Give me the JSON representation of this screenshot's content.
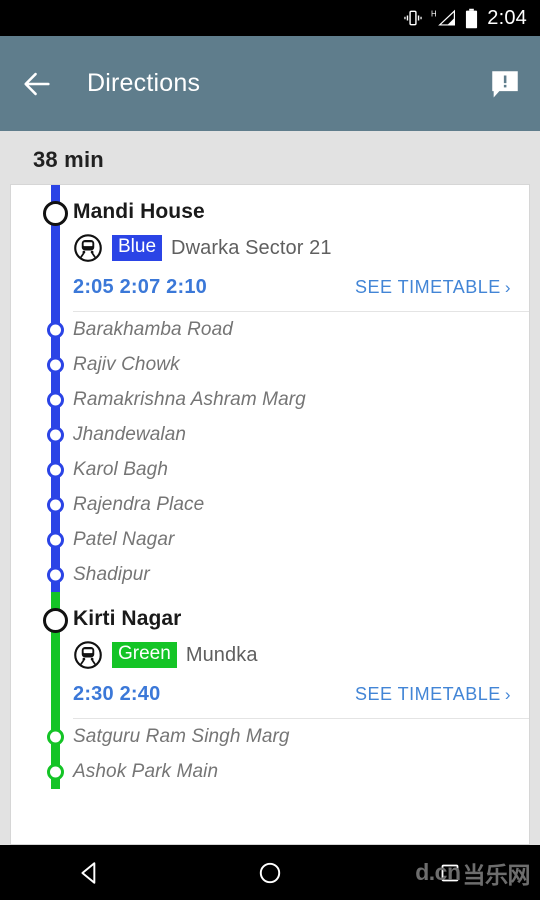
{
  "statusbar": {
    "time": "2:04",
    "icons": [
      "vibrate-icon",
      "network-h-icon",
      "battery-icon"
    ],
    "network_label": "H"
  },
  "toolbar": {
    "title": "Directions",
    "back_icon": "back-arrow-icon",
    "report_icon": "report-problem-icon",
    "background_color": "#5f7d8c"
  },
  "summary": {
    "duration": "38 min"
  },
  "legs": [
    {
      "color": "#2b44e6",
      "color_name": "blue",
      "station": "Mandi House",
      "mode_icon": "subway-icon",
      "line_badge": "Blue",
      "headsign": "Dwarka Sector 21",
      "departures": "2:05 2:07 2:10",
      "timetable_label": "SEE TIMETABLE",
      "timetable_chevron": "›",
      "stops": [
        "Barakhamba Road",
        "Rajiv Chowk",
        "Ramakrishna Ashram Marg",
        "Jhandewalan",
        "Karol Bagh",
        "Rajendra Place",
        "Patel Nagar",
        "Shadipur"
      ]
    },
    {
      "color": "#14c426",
      "color_name": "green",
      "station": "Kirti Nagar",
      "mode_icon": "subway-icon",
      "line_badge": "Green",
      "headsign": "Mundka",
      "departures": "2:30 2:40",
      "timetable_label": "SEE TIMETABLE",
      "timetable_chevron": "›",
      "stops": [
        "Satguru Ram Singh Marg",
        "Ashok Park Main"
      ]
    }
  ],
  "navbar": {
    "back": "nav-back-icon",
    "home": "nav-home-icon",
    "recents": "nav-recents-icon",
    "watermark": "d.cn",
    "watermark_cn": "当乐网"
  }
}
